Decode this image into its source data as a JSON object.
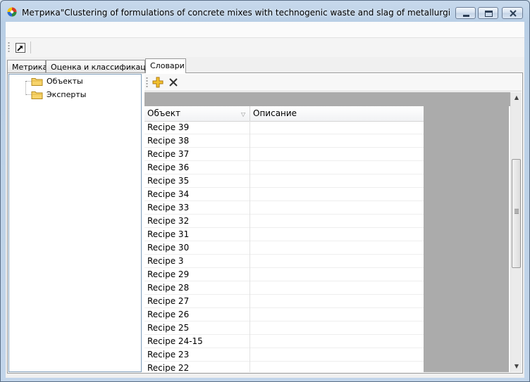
{
  "window": {
    "title": "Метрика\"Clustering of formulations of concrete mixes with technogenic waste and slag of metallurgical enterpri...",
    "controls": [
      "minimize-icon",
      "maximize-icon",
      "close-icon"
    ]
  },
  "toolbar": {
    "icon": "shortcut-arrow-icon"
  },
  "tabs": [
    {
      "label": "Метрика",
      "active": false
    },
    {
      "label": "Оценка и классификация",
      "active": false
    },
    {
      "label": "Словари",
      "active": true
    }
  ],
  "tree": {
    "items": [
      {
        "label": "Объекты",
        "icon": "folder-icon"
      },
      {
        "label": "Эксперты",
        "icon": "folder-icon"
      }
    ]
  },
  "grid_toolbar": {
    "icons": [
      "add-icon",
      "delete-icon"
    ]
  },
  "grid": {
    "columns": [
      "Объект",
      "Описание"
    ],
    "rows": [
      "Recipe 39",
      "Recipe 38",
      "Recipe 37",
      "Recipe 36",
      "Recipe 35",
      "Recipe 34",
      "Recipe 33",
      "Recipe 32",
      "Recipe 31",
      "Recipe 30",
      "Recipe 3",
      "Recipe 29",
      "Recipe 28",
      "Recipe 27",
      "Recipe 26",
      "Recipe 25",
      "Recipe 24-15",
      "Recipe 23",
      "Recipe 22"
    ]
  },
  "colors": {
    "grid_background": "#ababab",
    "title_bar": "#c8d9ec"
  }
}
